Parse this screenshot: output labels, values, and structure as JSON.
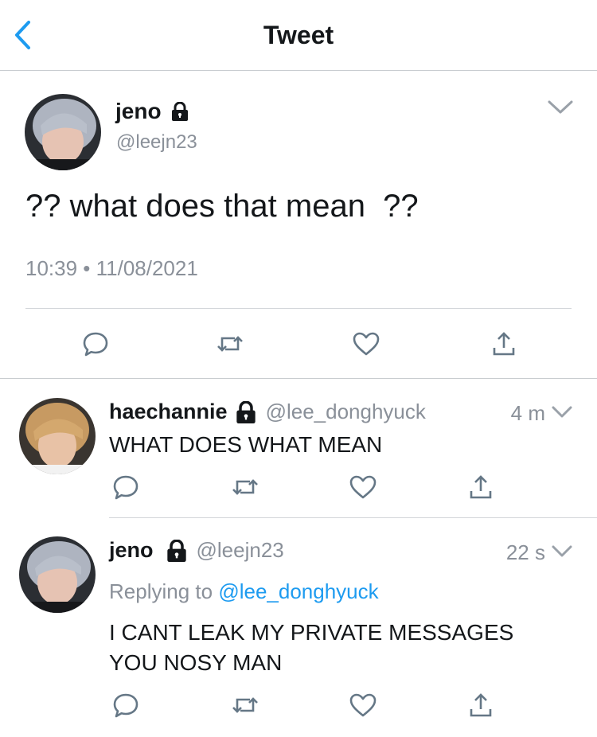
{
  "header": {
    "title": "Tweet",
    "back_icon": "chevron-left-icon",
    "accent": "#1d9bf0"
  },
  "main_tweet": {
    "name": "jeno",
    "handle": "@leejn23",
    "text": "?? what does that mean  ??",
    "timestamp": "10:39 • 11/08/2021",
    "protected_icon": "lock-icon"
  },
  "actions": [
    "reply-icon",
    "retweet-icon",
    "like-icon",
    "share-icon"
  ],
  "replies": [
    {
      "name": "haechannie",
      "handle": "@lee_donghyuck",
      "time": "4 m",
      "text": "WHAT DOES WHAT MEAN"
    },
    {
      "name": "jeno",
      "handle": "@leejn23",
      "time": "22 s",
      "replying_prefix": "Replying to",
      "replying_to": "@lee_donghyuck",
      "text_line1": "I CANT LEAK MY PRIVATE MESSAGES",
      "text_line2": "YOU NOSY MAN"
    }
  ]
}
